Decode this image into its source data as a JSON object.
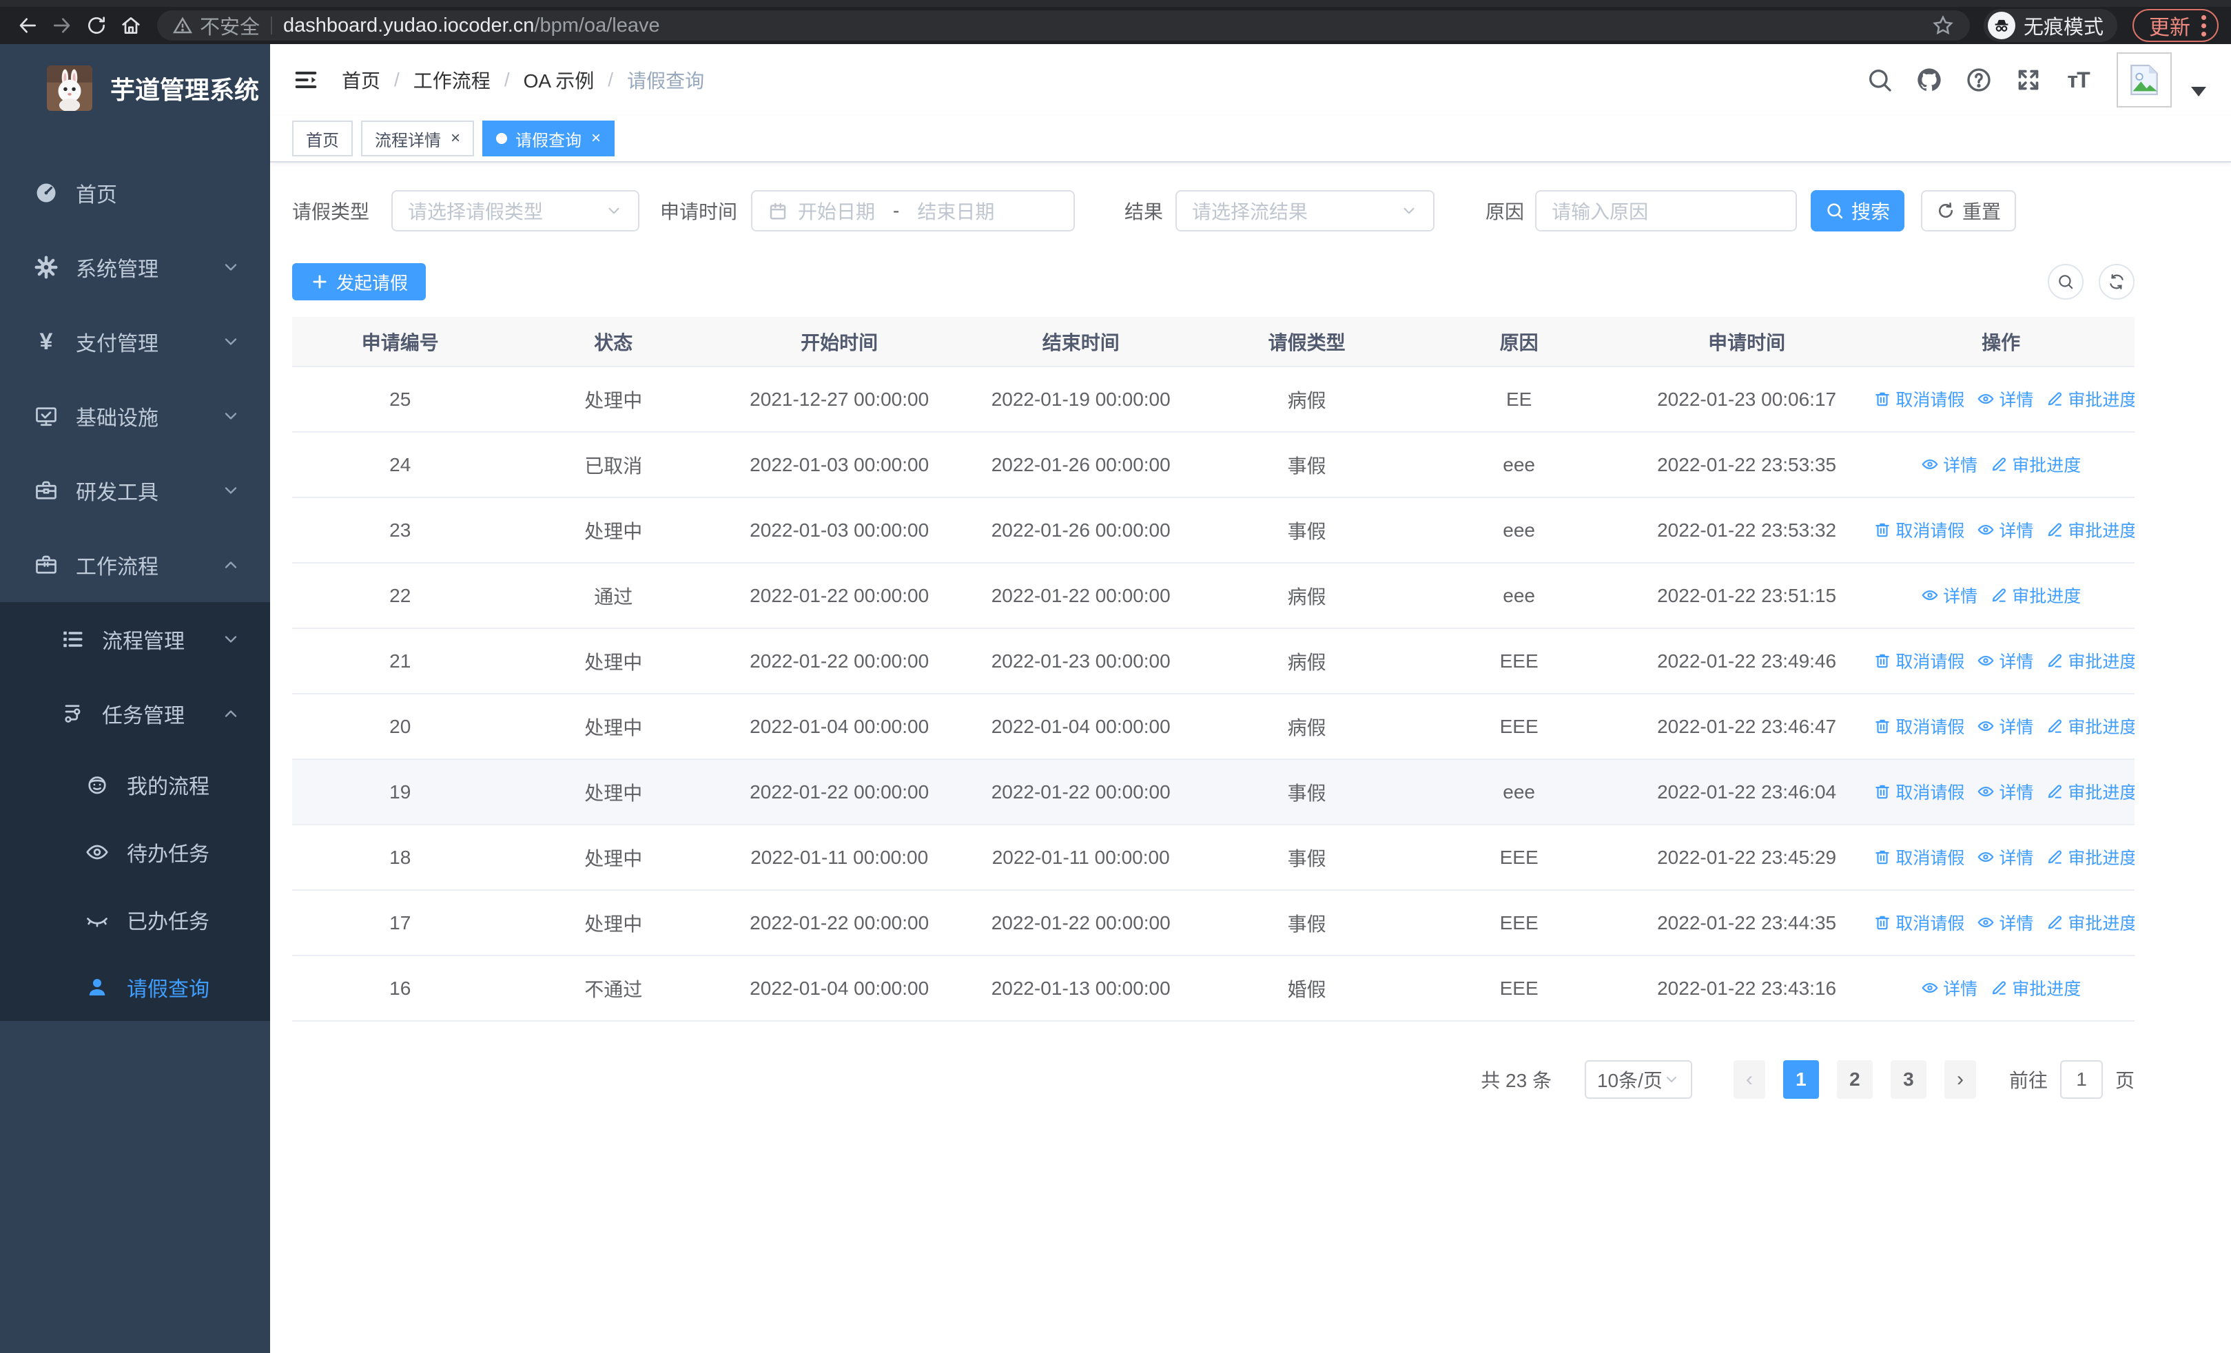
{
  "colors": {
    "primary": "#409eff",
    "sidebar_bg": "#304156",
    "submenu_bg": "#1f2d3d",
    "danger_accent": "#f08b82"
  },
  "browser": {
    "security_label": "不安全",
    "url_host": "dashboard.yudao.iocoder.cn",
    "url_path": "/bpm/oa/leave",
    "incognito_label": "无痕模式",
    "update_label": "更新"
  },
  "sidebar": {
    "title": "芋道管理系统",
    "menu": [
      {
        "key": "home",
        "label": "首页",
        "icon": "dashboard-icon",
        "level": 1,
        "chevron": "",
        "sub": false,
        "active": false
      },
      {
        "key": "system",
        "label": "系统管理",
        "icon": "gear-icon",
        "level": 1,
        "chevron": "down",
        "sub": false,
        "active": false
      },
      {
        "key": "payment",
        "label": "支付管理",
        "icon": "yen-icon",
        "level": 1,
        "chevron": "down",
        "sub": false,
        "active": false
      },
      {
        "key": "infrastructure",
        "label": "基础设施",
        "icon": "monitor-icon",
        "level": 1,
        "chevron": "down",
        "sub": false,
        "active": false
      },
      {
        "key": "dev-tools",
        "label": "研发工具",
        "icon": "toolbox-icon",
        "level": 1,
        "chevron": "down",
        "sub": false,
        "active": false
      },
      {
        "key": "workflow",
        "label": "工作流程",
        "icon": "briefcase-icon",
        "level": 1,
        "chevron": "up",
        "sub": false,
        "active": false
      },
      {
        "key": "process-mgmt",
        "label": "流程管理",
        "icon": "tree-list-icon",
        "level": 2,
        "chevron": "down",
        "sub": true,
        "active": false
      },
      {
        "key": "task-mgmt",
        "label": "任务管理",
        "icon": "flow-icon",
        "level": 2,
        "chevron": "up",
        "sub": true,
        "active": false
      },
      {
        "key": "my-process",
        "label": "我的流程",
        "icon": "face-icon",
        "level": 3,
        "chevron": "",
        "sub": true,
        "active": false
      },
      {
        "key": "todo-tasks",
        "label": "待办任务",
        "icon": "eye-icon",
        "level": 3,
        "chevron": "",
        "sub": true,
        "active": false
      },
      {
        "key": "done-tasks",
        "label": "已办任务",
        "icon": "eye-closed-icon",
        "level": 3,
        "chevron": "",
        "sub": true,
        "active": false
      },
      {
        "key": "leave-query",
        "label": "请假查询",
        "icon": "user-icon",
        "level": 3,
        "chevron": "",
        "sub": true,
        "active": true
      }
    ]
  },
  "header": {
    "breadcrumb": [
      "首页",
      "工作流程",
      "OA 示例",
      "请假查询"
    ]
  },
  "tabs": [
    {
      "label": "首页",
      "closable": false,
      "active": false
    },
    {
      "label": "流程详情",
      "closable": true,
      "active": false
    },
    {
      "label": "请假查询",
      "closable": true,
      "active": true
    }
  ],
  "filters": {
    "leave_type": {
      "label": "请假类型",
      "placeholder": "请选择请假类型"
    },
    "apply_time": {
      "label": "申请时间",
      "start_placeholder": "开始日期",
      "separator": "-",
      "end_placeholder": "结束日期"
    },
    "result": {
      "label": "结果",
      "placeholder": "请选择流结果"
    },
    "reason": {
      "label": "原因",
      "placeholder": "请输入原因"
    },
    "search_label": "搜索",
    "reset_label": "重置"
  },
  "toolbar": {
    "create_label": "发起请假"
  },
  "table": {
    "columns": [
      "申请编号",
      "状态",
      "开始时间",
      "结束时间",
      "请假类型",
      "原因",
      "申请时间",
      "操作"
    ],
    "action_defs": {
      "cancel": {
        "label": "取消请假",
        "icon": "trash-icon"
      },
      "detail": {
        "label": "详情",
        "icon": "view-eye-icon"
      },
      "progress": {
        "label": "审批进度",
        "icon": "pen-icon"
      }
    },
    "rows": [
      {
        "id": "25",
        "status": "处理中",
        "start": "2021-12-27 00:00:00",
        "end": "2022-01-19 00:00:00",
        "type": "病假",
        "reason": "EE",
        "apply": "2022-01-23 00:06:17",
        "actions": [
          "cancel",
          "detail",
          "progress"
        ],
        "hovered": false
      },
      {
        "id": "24",
        "status": "已取消",
        "start": "2022-01-03 00:00:00",
        "end": "2022-01-26 00:00:00",
        "type": "事假",
        "reason": "eee",
        "apply": "2022-01-22 23:53:35",
        "actions": [
          "detail",
          "progress"
        ],
        "hovered": false
      },
      {
        "id": "23",
        "status": "处理中",
        "start": "2022-01-03 00:00:00",
        "end": "2022-01-26 00:00:00",
        "type": "事假",
        "reason": "eee",
        "apply": "2022-01-22 23:53:32",
        "actions": [
          "cancel",
          "detail",
          "progress"
        ],
        "hovered": false
      },
      {
        "id": "22",
        "status": "通过",
        "start": "2022-01-22 00:00:00",
        "end": "2022-01-22 00:00:00",
        "type": "病假",
        "reason": "eee",
        "apply": "2022-01-22 23:51:15",
        "actions": [
          "detail",
          "progress"
        ],
        "hovered": false
      },
      {
        "id": "21",
        "status": "处理中",
        "start": "2022-01-22 00:00:00",
        "end": "2022-01-23 00:00:00",
        "type": "病假",
        "reason": "EEE",
        "apply": "2022-01-22 23:49:46",
        "actions": [
          "cancel",
          "detail",
          "progress"
        ],
        "hovered": false
      },
      {
        "id": "20",
        "status": "处理中",
        "start": "2022-01-04 00:00:00",
        "end": "2022-01-04 00:00:00",
        "type": "病假",
        "reason": "EEE",
        "apply": "2022-01-22 23:46:47",
        "actions": [
          "cancel",
          "detail",
          "progress"
        ],
        "hovered": false
      },
      {
        "id": "19",
        "status": "处理中",
        "start": "2022-01-22 00:00:00",
        "end": "2022-01-22 00:00:00",
        "type": "事假",
        "reason": "eee",
        "apply": "2022-01-22 23:46:04",
        "actions": [
          "cancel",
          "detail",
          "progress"
        ],
        "hovered": true
      },
      {
        "id": "18",
        "status": "处理中",
        "start": "2022-01-11 00:00:00",
        "end": "2022-01-11 00:00:00",
        "type": "事假",
        "reason": "EEE",
        "apply": "2022-01-22 23:45:29",
        "actions": [
          "cancel",
          "detail",
          "progress"
        ],
        "hovered": false
      },
      {
        "id": "17",
        "status": "处理中",
        "start": "2022-01-22 00:00:00",
        "end": "2022-01-22 00:00:00",
        "type": "事假",
        "reason": "EEE",
        "apply": "2022-01-22 23:44:35",
        "actions": [
          "cancel",
          "detail",
          "progress"
        ],
        "hovered": false
      },
      {
        "id": "16",
        "status": "不通过",
        "start": "2022-01-04 00:00:00",
        "end": "2022-01-13 00:00:00",
        "type": "婚假",
        "reason": "EEE",
        "apply": "2022-01-22 23:43:16",
        "actions": [
          "detail",
          "progress"
        ],
        "hovered": false
      }
    ]
  },
  "pagination": {
    "total_text": "共 23 条",
    "page_size": "10条/页",
    "pages": [
      "1",
      "2",
      "3"
    ],
    "active_page": "1",
    "prev_symbol": "‹",
    "next_symbol": "›",
    "goto_label": "前往",
    "goto_value": "1",
    "page_suffix": "页"
  }
}
